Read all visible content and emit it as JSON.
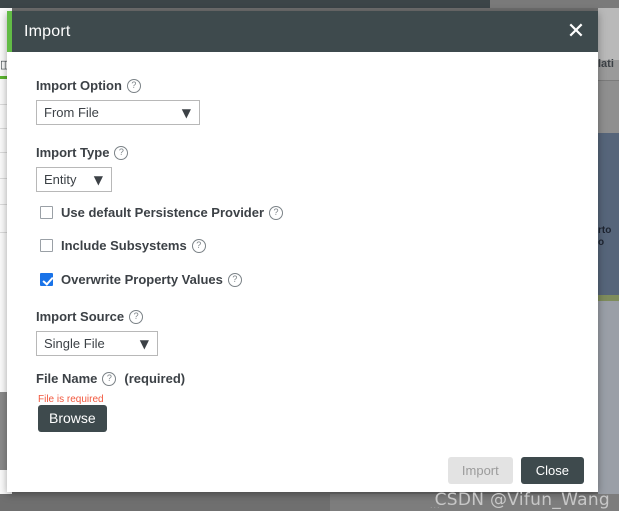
{
  "background": {
    "left_panel": {
      "icon": "tree-node-icon"
    },
    "right_panel": {
      "header_text": "lati",
      "body_text_line1": "rto",
      "body_text_line2": "o"
    },
    "bottom_text": "..."
  },
  "dialog": {
    "title": "Import",
    "close_icon_label": "✕",
    "accent_color": "#62bb46",
    "header_color": "#3e4a4d",
    "fields": {
      "import_option": {
        "label": "Import Option",
        "help": "?",
        "value": "From File",
        "arrow": "▼"
      },
      "import_type": {
        "label": "Import Type",
        "help": "?",
        "value": "Entity",
        "arrow": "▼"
      },
      "import_source": {
        "label": "Import Source",
        "help": "?",
        "value": "Single File",
        "arrow": "▼"
      },
      "file_name": {
        "label": "File Name",
        "help": "?",
        "required_note": "(required)",
        "error": "File is required",
        "browse_label": "Browse"
      }
    },
    "checkboxes": [
      {
        "label": "Use default Persistence Provider",
        "help": "?",
        "checked": false
      },
      {
        "label": "Include Subsystems",
        "help": "?",
        "checked": false
      },
      {
        "label": "Overwrite Property Values",
        "help": "?",
        "checked": true
      }
    ],
    "footer": {
      "import_label": "Import",
      "close_label": "Close",
      "import_disabled": true
    }
  },
  "watermark": {
    "text": "CSDN @Vifun_Wang"
  },
  "colors": {
    "accent_green": "#62bb46",
    "header_dark": "#3e4a4d",
    "checkbox_blue": "#1a73e8",
    "error_red": "#f2583e"
  }
}
